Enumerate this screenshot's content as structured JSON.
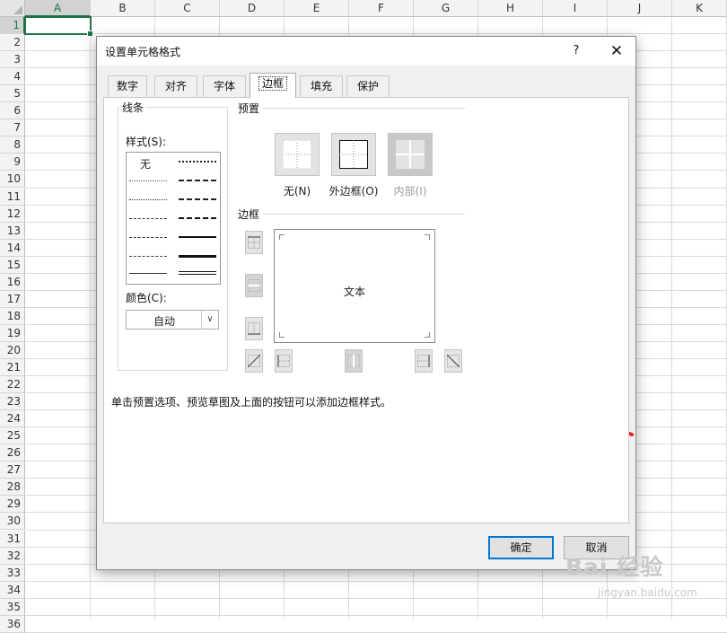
{
  "spreadsheet": {
    "columns": [
      "A",
      "B",
      "C",
      "D",
      "E",
      "F",
      "G",
      "H",
      "I",
      "J",
      "K"
    ],
    "rows": [
      "1",
      "2",
      "3",
      "4",
      "5",
      "6",
      "7",
      "8",
      "9",
      "10",
      "11",
      "12",
      "13",
      "14",
      "15",
      "16",
      "17",
      "18",
      "19",
      "20",
      "21",
      "22",
      "23",
      "24",
      "25",
      "26",
      "27",
      "28",
      "29",
      "30",
      "31",
      "32",
      "33",
      "34",
      "35",
      "36"
    ],
    "selected_cell": "A1",
    "accent_color": "#217346"
  },
  "dialog": {
    "title": "设置单元格格式",
    "help_label": "?",
    "close_label": "✕",
    "tabs": [
      {
        "label": "数字"
      },
      {
        "label": "对齐"
      },
      {
        "label": "字体"
      },
      {
        "label": "边框"
      },
      {
        "label": "填充"
      },
      {
        "label": "保护"
      }
    ],
    "active_tab": "边框",
    "line": {
      "group_title": "线条",
      "style_label": "样式(S):",
      "style_none": "无",
      "color_label": "颜色(C):",
      "color_value": "自动"
    },
    "presets": {
      "group_title": "预置",
      "items": [
        {
          "label": "无(N)",
          "enabled": true
        },
        {
          "label": "外边框(O)",
          "enabled": true
        },
        {
          "label": "内部(I)",
          "enabled": false
        }
      ]
    },
    "border": {
      "group_title": "边框",
      "preview_text": "文本"
    },
    "hint": "单击预置选项、预览草图及上面的按钮可以添加边框样式。",
    "ok_label": "确定",
    "cancel_label": "取消"
  },
  "watermark": {
    "main": "Bai 经验",
    "sub": "jingyan.baidu.com"
  },
  "annotation": {
    "arrow_color": "#e02424"
  }
}
